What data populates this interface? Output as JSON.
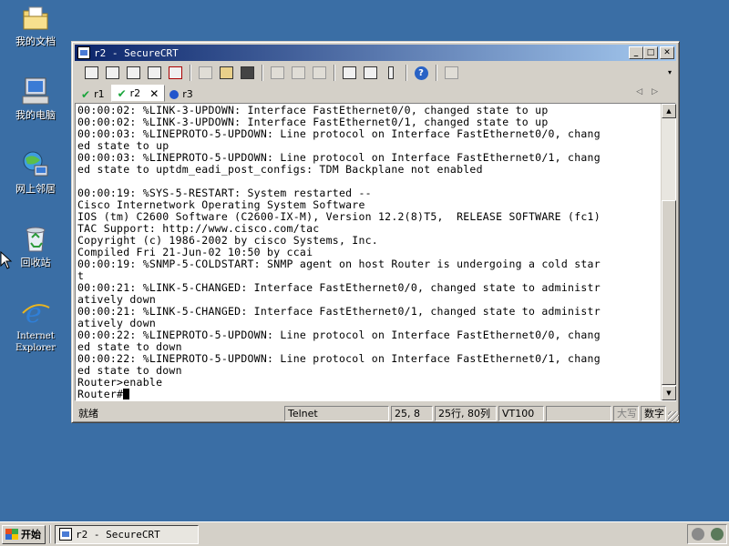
{
  "desktop": {
    "icons": [
      {
        "label": "我的文档"
      },
      {
        "label": "我的电脑"
      },
      {
        "label": "网上邻居"
      },
      {
        "label": "回收站"
      },
      {
        "label": "Internet Explorer"
      }
    ]
  },
  "window": {
    "title": "r2 - SecureCRT",
    "min_glyph": "_",
    "max_glyph": "□",
    "close_glyph": "✕"
  },
  "tabs": [
    {
      "label": "r1",
      "icon": "check-icon"
    },
    {
      "label": "r2",
      "icon": "check-icon",
      "close": "✕"
    },
    {
      "label": "r3",
      "icon": "info-icon"
    }
  ],
  "tab_nav": {
    "prev": "◁",
    "next": "▷"
  },
  "terminal": {
    "lines": [
      "00:00:02: %LINK-3-UPDOWN: Interface FastEthernet0/0, changed state to up",
      "00:00:02: %LINK-3-UPDOWN: Interface FastEthernet0/1, changed state to up",
      "00:00:03: %LINEPROTO-5-UPDOWN: Line protocol on Interface FastEthernet0/0, chang",
      "ed state to up",
      "00:00:03: %LINEPROTO-5-UPDOWN: Line protocol on Interface FastEthernet0/1, chang",
      "ed state to uptdm_eadi_post_configs: TDM Backplane not enabled",
      "",
      "00:00:19: %SYS-5-RESTART: System restarted --",
      "Cisco Internetwork Operating System Software",
      "IOS (tm) C2600 Software (C2600-IX-M), Version 12.2(8)T5,  RELEASE SOFTWARE (fc1)",
      "TAC Support: http://www.cisco.com/tac",
      "Copyright (c) 1986-2002 by cisco Systems, Inc.",
      "Compiled Fri 21-Jun-02 10:50 by ccai",
      "00:00:19: %SNMP-5-COLDSTART: SNMP agent on host Router is undergoing a cold star",
      "t",
      "00:00:21: %LINK-5-CHANGED: Interface FastEthernet0/0, changed state to administr",
      "atively down",
      "00:00:21: %LINK-5-CHANGED: Interface FastEthernet0/1, changed state to administr",
      "atively down",
      "00:00:22: %LINEPROTO-5-UPDOWN: Line protocol on Interface FastEthernet0/0, chang",
      "ed state to down",
      "00:00:22: %LINEPROTO-5-UPDOWN: Line protocol on Interface FastEthernet0/1, chang",
      "ed state to down",
      "Router>enable"
    ],
    "prompt": "Router#"
  },
  "statusbar": {
    "ready": "就绪",
    "protocol": "Telnet",
    "cursor_pos": "25,  8",
    "size": "25行, 80列",
    "emulation": "VT100",
    "caps": "大写",
    "num": "数字"
  },
  "taskbar": {
    "start": "开始",
    "task": "r2 - SecureCRT"
  }
}
